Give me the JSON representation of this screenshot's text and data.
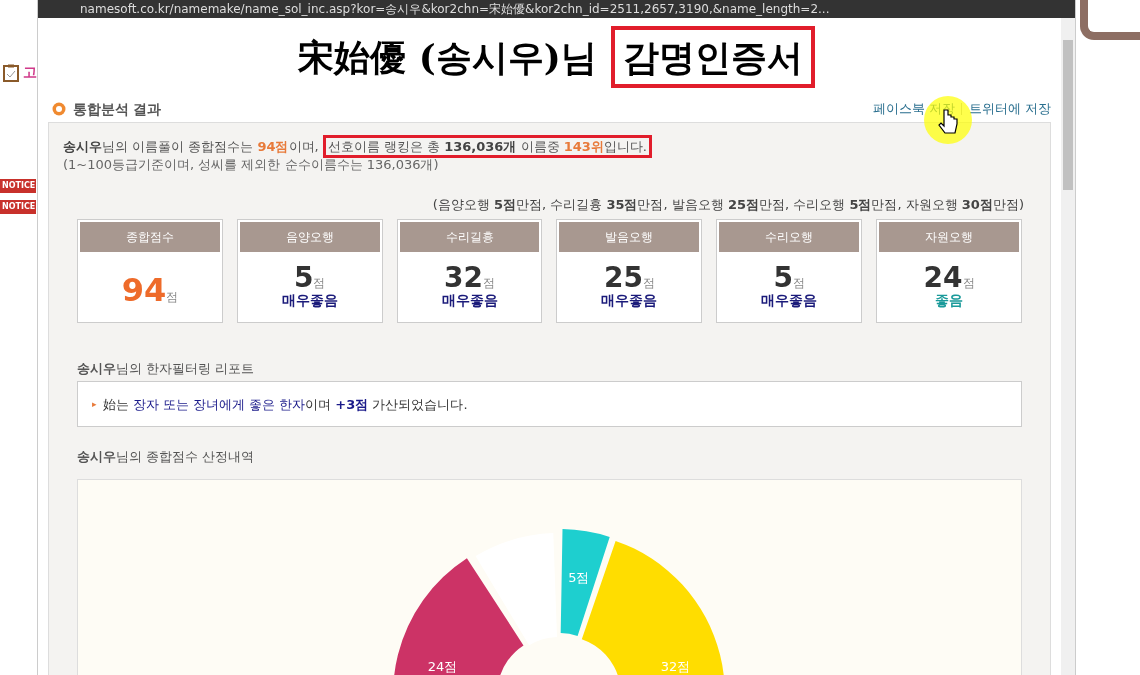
{
  "address_bar": {
    "url": "namesoft.co.kr/namemake/name_sol_inc.asp?kor=송시우&kor2chn=宋始優&kor2chn_id=2511,2657,3190,&name_length=2..."
  },
  "background_page": {
    "tab_label": "고",
    "notices": [
      "NOTICE",
      "NOTICE"
    ]
  },
  "title": [
    {
      "text": "宋始優 (송시우)님",
      "boxed": false
    },
    {
      "text": "감명인증서",
      "boxed": true
    }
  ],
  "section_title": "통합분석 결과",
  "share_links": [
    "페이스북 저장",
    "트위터에 저장"
  ],
  "summary": {
    "parts": [
      {
        "text": "송시우",
        "kind": "strong"
      },
      {
        "text": "님의 이름풀이 종합점수는 ",
        "kind": "plain"
      },
      {
        "text": "94점",
        "kind": "accent"
      },
      {
        "text": "이며, ",
        "kind": "plain"
      }
    ],
    "highlighted_parts": [
      {
        "text": "선호이름 랭킹은 총 ",
        "kind": "plain"
      },
      {
        "text": "136,036개",
        "kind": "strong"
      },
      {
        "text": " 이름중 ",
        "kind": "plain"
      },
      {
        "text": "143위",
        "kind": "accent"
      },
      {
        "text": "입니다.",
        "kind": "plain"
      }
    ],
    "note": "(1~100등급기준이며, 성씨를 제외한 순수이름수는 136,036개)"
  },
  "max_scores_note": "(음양오행 **5점**만점, 수리길흉 **35점**만점, 발음오행 **25점**만점, 수리오행 **5점**만점, 자원오행 **30점**만점)",
  "score_cards": [
    {
      "kind": "total",
      "title": "종합점수",
      "score": "94",
      "unit": "점"
    },
    {
      "kind": "part",
      "title": "음양오행",
      "score": "5",
      "unit": "점",
      "grade": {
        "text": "매우좋음",
        "color": "#1a1a7a"
      }
    },
    {
      "kind": "part",
      "title": "수리길흉",
      "score": "32",
      "unit": "점",
      "grade": {
        "text": "매우좋음",
        "color": "#1a1a7a"
      }
    },
    {
      "kind": "part",
      "title": "발음오행",
      "score": "25",
      "unit": "점",
      "grade": {
        "text": "매우좋음",
        "color": "#1a1a7a"
      }
    },
    {
      "kind": "part",
      "title": "수리오행",
      "score": "5",
      "unit": "점",
      "grade": {
        "text": "매우좋음",
        "color": "#1a1a7a"
      }
    },
    {
      "kind": "part",
      "title": "자원오행",
      "score": "24",
      "unit": "점",
      "grade": {
        "text": "좋음",
        "color": "#1a9a9a"
      }
    }
  ],
  "filter_report": {
    "heading": "**송시우**님의 한자필터링 리포트",
    "bullet": "▸",
    "parts": [
      {
        "text": "始는 ",
        "kind": "plain"
      },
      {
        "text": "장자 또는 장녀에게 좋은 한자",
        "kind": "link"
      },
      {
        "text": "이며 ",
        "kind": "plain"
      },
      {
        "text": "+3점",
        "kind": "linkbold"
      },
      {
        "text": " 가산되었습니다.",
        "kind": "plain"
      }
    ]
  },
  "breakdown": {
    "heading": "**송시우**님의 종합점수 산정내역",
    "slices": [
      {
        "label": "5점",
        "color": "#1ecfcf"
      },
      {
        "label": "32점",
        "color": "#ffdd00"
      },
      {
        "label": "24점",
        "color": "#cc3366"
      },
      {
        "color": "#ffffff"
      }
    ]
  }
}
